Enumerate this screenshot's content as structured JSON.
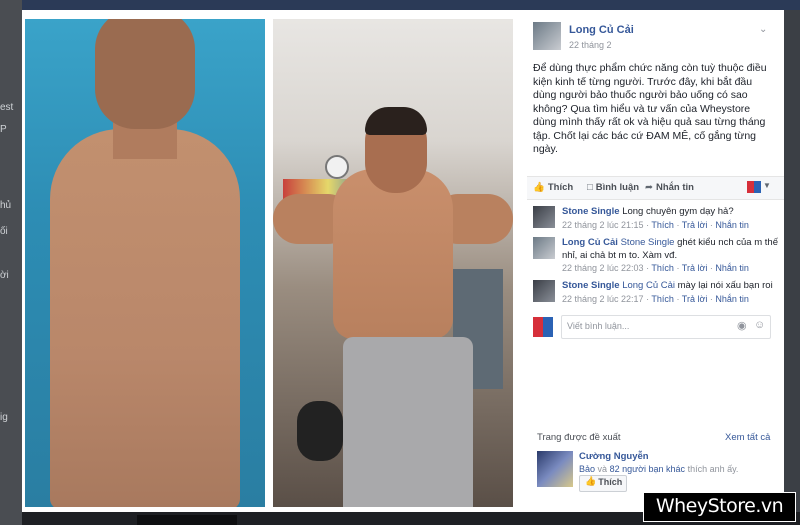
{
  "post": {
    "author": "Long Củ Cải",
    "date": "22 tháng 2",
    "text": "Để dùng thực phẩm chức năng còn tuỳ thuộc điều kiện kinh tế từng người. Trước đây, khi bắt đầu dùng người bảo thuốc người bảo uống có sao không? Qua tìm hiểu và tư vấn của Wheystore dùng mình thấy rất ok và hiệu quả sau từng tháng tập. Chốt lại các bác cứ ĐAM MÊ, cố gắng từng ngày."
  },
  "actions": {
    "like": "Thích",
    "comment": "Bình luận",
    "share": "Nhắn tin",
    "icons": [
      "thumbs-up-icon",
      "comment-icon",
      "share-icon",
      "flag-icon",
      "caret-down-icon"
    ]
  },
  "comments": [
    {
      "name": "Stone Single",
      "tag": "",
      "text": "Long chuyên gym dạy hả?",
      "time": "22 tháng 2 lúc 21:15",
      "like": "Thích",
      "reply": "Trả lời",
      "message": "Nhắn tin"
    },
    {
      "name": "Long Củ Cải",
      "tag": "Stone Single",
      "text": "ghét kiểu nch của m thế nhỉ, ai chả bt m to. Xàm vđ.",
      "time": "22 tháng 2 lúc 22:03",
      "like": "Thích",
      "reply": "Trả lời",
      "message": "Nhắn tin"
    },
    {
      "name": "Stone Single",
      "tag": "Long Củ Cải",
      "text": "mày lại nói xấu bạn roi",
      "time": "22 tháng 2 lúc 22:17",
      "like": "Thích",
      "reply": "Trả lời",
      "message": "Nhắn tin"
    }
  ],
  "reply_box": {
    "placeholder": "Viết bình luận..."
  },
  "suggestions": {
    "title": "Trang được đề xuất",
    "see_all": "Xem tất cả",
    "page_name": "Cường Nguyễn",
    "friend": "Bảo",
    "and_word": "và",
    "others": "82 người bạn khác",
    "suffix": "thích anh ấy.",
    "like_button": "Thích"
  },
  "watermark": "WheyStore.vn",
  "background_fragments": [
    "est",
    "P",
    "hủ",
    "ối",
    "ời",
    "ig"
  ],
  "colors": {
    "link": "#365899",
    "meta": "#90949c",
    "text": "#1d2129",
    "panel_bg": "#ffffff",
    "backdrop": "#3b3f45"
  }
}
